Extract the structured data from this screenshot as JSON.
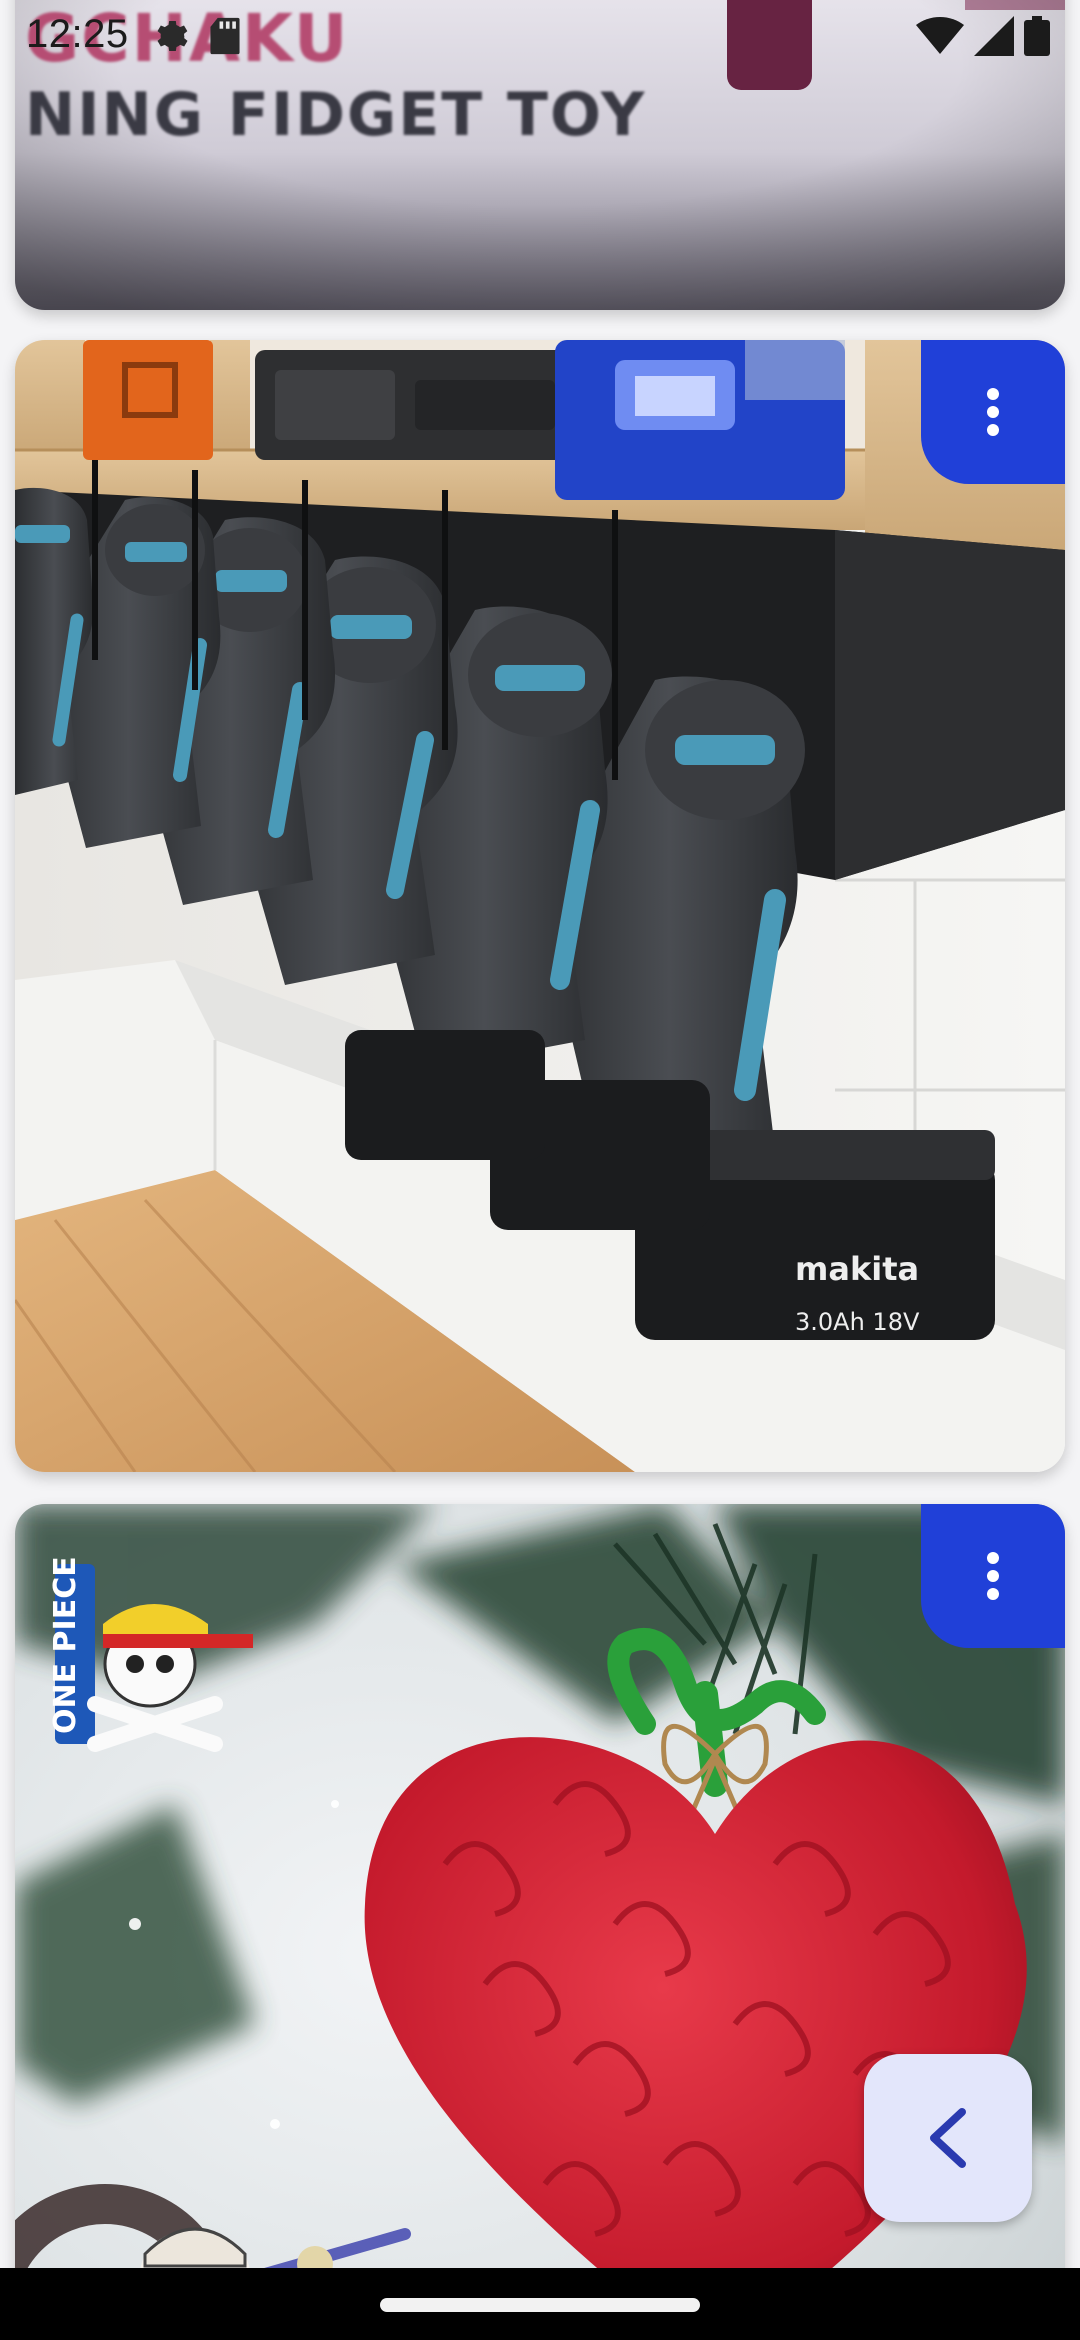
{
  "status_bar": {
    "time": "12:25",
    "left_icons": [
      "settings-icon",
      "sd-card-icon"
    ],
    "right_icons": [
      "wifi-icon",
      "cell-signal-icon",
      "battery-icon"
    ]
  },
  "feed": {
    "cards": [
      {
        "image": "fidget-toy-photo",
        "title_line_1": "GCHAKU",
        "title_line_2": "NING FIDGET TOY"
      },
      {
        "image": "makita-drill-wall-holder-photo",
        "battery_label_brand": "makita",
        "battery_label_spec": "3.0Ah 18V",
        "has_more_button": true
      },
      {
        "image": "heart-devil-fruit-ornament-photo",
        "has_more_button": true
      }
    ]
  },
  "colors": {
    "accent_button": "#2040d8",
    "fab_background": "#e3e6fb",
    "fab_icon": "#2a3ab0"
  },
  "navigation": {
    "back_button_icon": "chevron-left-icon",
    "gesture_handle": "home-indicator"
  }
}
